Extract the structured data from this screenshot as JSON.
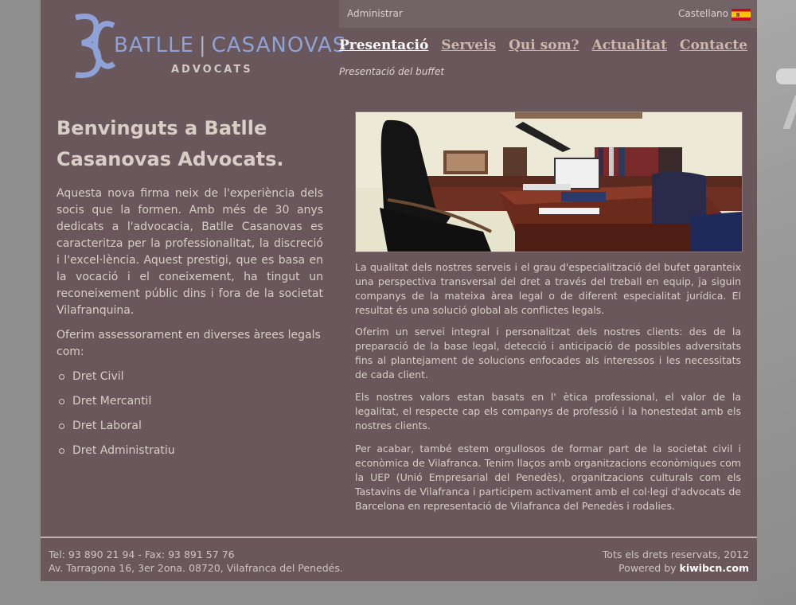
{
  "brand": {
    "name_left": "BATLLE",
    "name_right": "CASANOVAS",
    "separator": "|",
    "subtitle": "ADVOCATS",
    "logo_color": "#8ea2d8"
  },
  "topbar": {
    "admin_label": "Administrar",
    "language_label": "Castellano",
    "flag_icon": "spain-flag-icon"
  },
  "nav": {
    "items": [
      {
        "label": "Presentació",
        "active": true
      },
      {
        "label": "Serveis"
      },
      {
        "label": "Qui som?"
      },
      {
        "label": "Actualitat"
      },
      {
        "label": "Contacte"
      }
    ],
    "subtitle": "Presentació del buffet"
  },
  "left": {
    "heading": "Benvinguts a Batlle Casanovas Advocats.",
    "intro": "Aquesta nova firma neix de l'experiència dels socis que la formen. Amb més de 30 anys dedicats a l'advocacia, Batlle Casanovas es caracteritza per la professionalitat, la discreció i l'excel·lència. Aquest prestigi, que es basa en la vocació i el coneixement, ha tingut un reconeixement públic dins i fora de la societat Vilafranquina.",
    "offer": "Oferim assessorament en diverses àrees legals com:",
    "areas": [
      "Dret Civil",
      "Dret Mercantil",
      "Dret Laboral",
      "Dret Administratiu"
    ]
  },
  "right": {
    "p1": "La qualitat dels nostres serveis i el grau d'especialització del bufet garanteix una perspectiva transversal del dret a través del treball en equip, ja siguin companys de la mateixa àrea legal o de diferent especialitat jurídica. El resultat és una solució global als conflictes legals.",
    "p2": "Oferim un servei integral i personalitzat dels nostres clients: des de la preparació de la base legal, detecció i anticipació de possibles adversitats fins al plantejament de solucions enfocades als interessos i les necessitats de cada client.",
    "p3": "Els nostres valors estan basats en l' ètica professional, el valor de la legalitat, el respecte cap els companys de professió i la honestedat amb els nostres clients.",
    "p4": "Per acabar, també estem orgullosos de formar part de la societat civil i econòmica de Vilafranca. Tenim llaços amb organitzacions econòmiques com la UEP (Unió Empresarial del Penedès), organitzacions culturals com els Tastavins de Vilafranca i participem activament amb el col·legi d'advocats de Barcelona en representació de Vilafranca del Penedès i rodalies."
  },
  "footer": {
    "phone": "Tel: 93 890 21 94 - Fax: 93 891 57 76",
    "address": "Av. Tarragona 16, 3er 2ona. 08720, Vilafranca del Penedés.",
    "rights": "Tots els drets reservats, 2012",
    "powered_label": "Powered by",
    "powered_link": "kiwibcn.com"
  },
  "colors": {
    "page_bg": "#6a575b",
    "outer_bg": "#8e8e8e",
    "text": "#d8cec6",
    "nav_link": "#cdb6aa"
  }
}
